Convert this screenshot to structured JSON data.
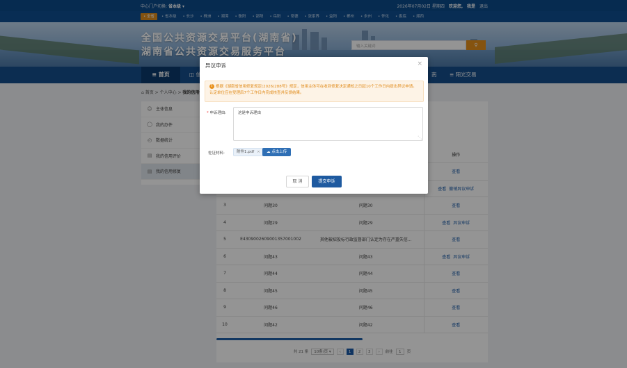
{
  "header": {
    "current_site_label": "中心门户切换:",
    "current_site": "省本级 ▾",
    "date": "2026年07月02日 星期四",
    "welcome": "欢迎您,",
    "user": "我是",
    "logout": "退出",
    "current_region": "• 全省",
    "regions": [
      "• 省本级",
      "• 长沙",
      "• 株洲",
      "• 湘潭",
      "• 衡阳",
      "• 邵阳",
      "• 岳阳",
      "• 常德",
      "• 张家界",
      "• 益阳",
      "• 郴州",
      "• 永州",
      "• 怀化",
      "• 娄底",
      "• 湘西"
    ],
    "title_line1": "全国公共资源交易平台(湖南省)",
    "title_line2": "湖南省公共资源交易服务平台",
    "search_placeholder": "输入关键词",
    "search_icon": "search-icon"
  },
  "nav": {
    "home": "≡ 首页",
    "item2": "◫ 信",
    "item3": "南",
    "item4": "≡ 阳光交易"
  },
  "breadcrumb": {
    "path": "首页 > 个人中心 > ",
    "current": "我的信用修"
  },
  "sidebar": {
    "items": [
      {
        "label": "主体信息",
        "icon": "user-icon"
      },
      {
        "label": "我的办件",
        "icon": "document-icon"
      },
      {
        "label": "数据统计",
        "icon": "clock-icon"
      },
      {
        "label": "我的信用评价",
        "icon": "report-icon"
      },
      {
        "label": "我的信用修复",
        "icon": "report-icon"
      }
    ]
  },
  "table": {
    "header_action": "操作",
    "rows": [
      {
        "no": "",
        "code": "",
        "reason": "",
        "actions": [
          "查看"
        ]
      },
      {
        "no": "",
        "code": "",
        "reason": "",
        "actions": [
          "查看",
          "撤销异议申诉"
        ]
      },
      {
        "no": "3",
        "code": "问题30",
        "reason": "问题30",
        "actions": [
          "查看"
        ]
      },
      {
        "no": "4",
        "code": "问题29",
        "reason": "问题29",
        "actions": [
          "查看",
          "异议申诉"
        ]
      },
      {
        "no": "5",
        "code": "E430900260900135700100​2",
        "reason": "其他被招投标行政监督部门认定为存在严重失信...",
        "actions": [
          "查看"
        ]
      },
      {
        "no": "6",
        "code": "问题43",
        "reason": "问题43",
        "actions": [
          "查看",
          "异议申诉"
        ]
      },
      {
        "no": "7",
        "code": "问题44",
        "reason": "问题44",
        "actions": [
          "查看"
        ]
      },
      {
        "no": "8",
        "code": "问题45",
        "reason": "问题45",
        "actions": [
          "查看"
        ]
      },
      {
        "no": "9",
        "code": "问题46",
        "reason": "问题46",
        "actions": [
          "查看"
        ]
      },
      {
        "no": "10",
        "code": "问题42",
        "reason": "问题42",
        "actions": [
          "查看"
        ]
      }
    ]
  },
  "pagination": {
    "total": "共 21 条",
    "page_size": "10条/页 ▾",
    "prev": "‹",
    "pages": [
      "1",
      "2",
      "3"
    ],
    "next": "›",
    "goto_label": "前往",
    "goto_value": "1",
    "goto_unit": "页"
  },
  "modal": {
    "title": "异议申诉",
    "close": "×",
    "notice": "根据《湖南省信用修复规定(2026)288号》规定，信用主体可在收到修复决定通知之日起10个工作日内提出异议申请。认定单位应在受理后7个工作日内完成核查并反馈结果。",
    "reason_label": "申诉理由:",
    "reason_value": "这是申诉理由",
    "material_label": "佐证材料:",
    "file_name": "附件1.pdf",
    "file_remove": "×",
    "upload_label": "点击上传",
    "cancel": "取 消",
    "submit": "提交申诉"
  }
}
